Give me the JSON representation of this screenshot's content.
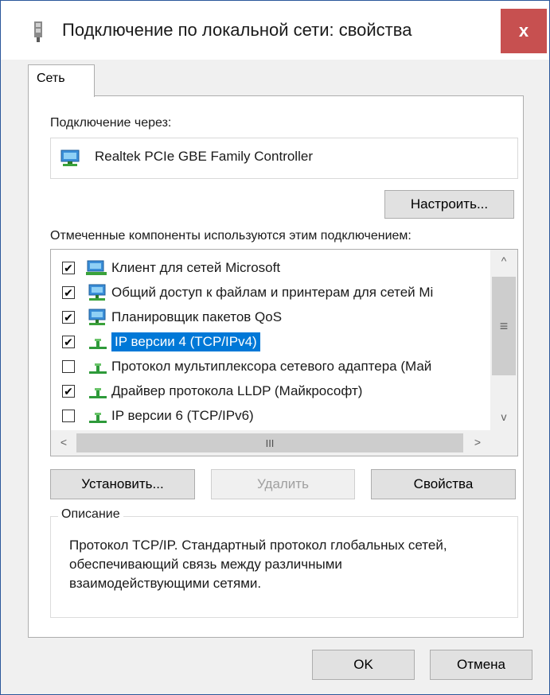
{
  "window": {
    "title": "Подключение по локальной сети: свойства",
    "close_glyph": "x"
  },
  "tabs": [
    {
      "label": "Сеть",
      "active": true
    }
  ],
  "connection": {
    "label": "Подключение через:",
    "adapter_name": "Realtek PCIe GBE Family Controller",
    "adapter_icon": "network-adapter-icon",
    "configure_label": "Настроить..."
  },
  "components": {
    "label": "Отмеченные компоненты используются этим подключением:",
    "items": [
      {
        "label": "Клиент для сетей Microsoft",
        "checked": true,
        "icon": "network-client-icon",
        "selected": false
      },
      {
        "label": "Общий доступ к файлам и принтерам для сетей Mi",
        "checked": true,
        "icon": "network-service-icon",
        "selected": false
      },
      {
        "label": "Планировщик пакетов QoS",
        "checked": true,
        "icon": "network-service-icon",
        "selected": false
      },
      {
        "label": "IP версии 4 (TCP/IPv4)",
        "checked": true,
        "icon": "protocol-icon",
        "selected": true
      },
      {
        "label": "Протокол мультиплексора сетевого адаптера (Май",
        "checked": false,
        "icon": "protocol-icon",
        "selected": false
      },
      {
        "label": "Драйвер протокола LLDP (Майкрософт)",
        "checked": true,
        "icon": "protocol-icon",
        "selected": false
      },
      {
        "label": "IP версии 6 (TCP/IPv6)",
        "checked": false,
        "icon": "protocol-icon",
        "selected": false
      }
    ],
    "scroll_up": "^",
    "scroll_down": "v",
    "scroll_left": "<",
    "scroll_right": ">",
    "vthumb_grip": "≡",
    "hthumb_grip": "III"
  },
  "actions": {
    "install_label": "Установить...",
    "remove_label": "Удалить",
    "properties_label": "Свойства"
  },
  "description": {
    "legend": "Описание",
    "text": "Протокол TCP/IP. Стандартный протокол глобальных сетей, обеспечивающий связь между различными взаимодействующими сетями."
  },
  "footer": {
    "ok_label": "OK",
    "cancel_label": "Отмена"
  },
  "colors": {
    "selection": "#0078d7",
    "close_button": "#c75050",
    "window_border": "#2b579a"
  }
}
